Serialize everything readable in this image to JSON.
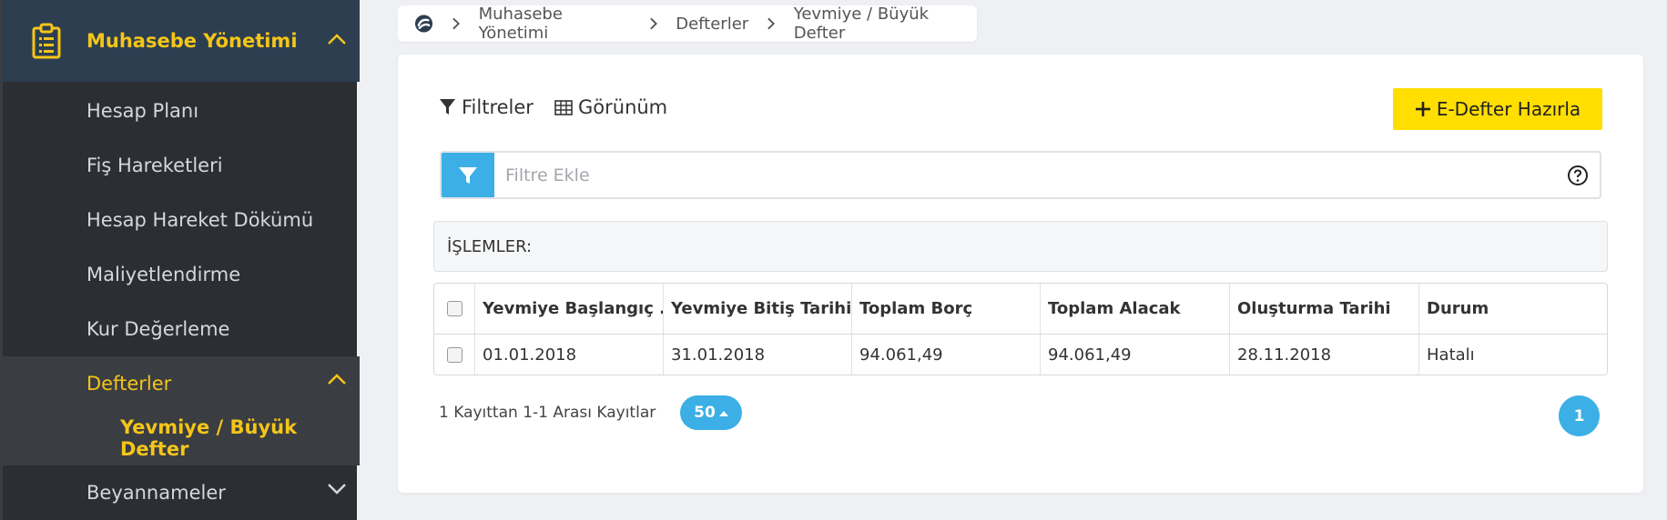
{
  "sidebar": {
    "header_title": "Muhasebe Yönetimi",
    "items": [
      {
        "label": "Hesap Planı"
      },
      {
        "label": "Fiş Hareketleri"
      },
      {
        "label": "Hesap Hareket Dökümü"
      },
      {
        "label": "Maliyetlendirme"
      },
      {
        "label": "Kur Değerleme"
      },
      {
        "label": "Defterler"
      },
      {
        "label": "Yevmiye / Büyük Defter"
      },
      {
        "label": "Beyannameler"
      }
    ]
  },
  "breadcrumb": {
    "items": [
      "Muhasebe Yönetimi",
      "Defterler",
      "Yevmiye / Büyük Defter"
    ]
  },
  "toolbar": {
    "filters_label": "Filtreler",
    "view_label": "Görünüm",
    "edefter_label": "E-Defter Hazırla"
  },
  "filter": {
    "placeholder": "Filtre Ekle",
    "value": ""
  },
  "operations_label": "İŞLEMLER:",
  "table": {
    "columns": [
      "Yevmiye Başlangıç ...",
      "Yevmiye Bitiş Tarihi",
      "Toplam Borç",
      "Toplam Alacak",
      "Oluşturma Tarihi",
      "Durum"
    ],
    "rows": [
      [
        "01.01.2018",
        "31.01.2018",
        "94.061,49",
        "94.061,49",
        "28.11.2018",
        "Hatalı"
      ]
    ]
  },
  "pagination": {
    "records_text": "1 Kayıttan 1-1 Arası Kayıtlar",
    "page_size": "50",
    "current_page": "1"
  },
  "colors": {
    "accent_yellow": "#f5c518",
    "button_yellow": "#ffde00",
    "primary_blue": "#3bafe6",
    "sidebar_dark": "#2b2e33",
    "sidebar_header": "#2c3e50"
  }
}
